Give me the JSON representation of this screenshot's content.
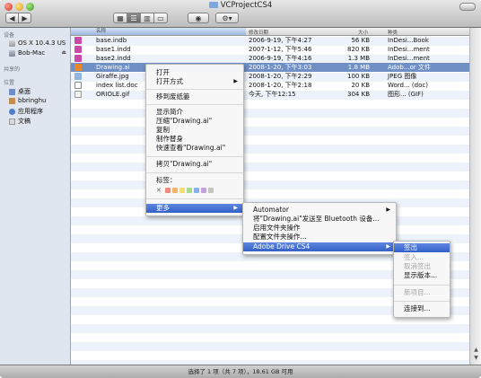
{
  "window": {
    "title": "VCProjectCS4"
  },
  "toolbar": {
    "back": "◀",
    "forward": "▶",
    "quicklook": "◉",
    "action": "⚙▾"
  },
  "sidebar": {
    "devices_header": "设备",
    "devices": [
      {
        "label": "OS X 10.4.3 US",
        "icon": "hard-disk-icon"
      },
      {
        "label": "Bob-Mac",
        "icon": "computer-icon",
        "eject": "⏏"
      }
    ],
    "shared_header": "共享的",
    "places_header": "位置",
    "places": [
      {
        "label": "桌面",
        "icon": "desktop-icon"
      },
      {
        "label": "bbringhu",
        "icon": "home-icon"
      },
      {
        "label": "应用程序",
        "icon": "applications-icon"
      },
      {
        "label": "文稿",
        "icon": "documents-icon"
      }
    ]
  },
  "columns": {
    "name": "名称",
    "date": "修改日期",
    "size": "大小",
    "kind": "种类"
  },
  "files": [
    {
      "name": "base.indb",
      "date": "2006-9-19, 下午4:27",
      "size": "56 KB",
      "kind": "InDesi...Book",
      "type": "indd"
    },
    {
      "name": "base1.indd",
      "date": "2007-1-12, 下午5:46",
      "size": "820 KB",
      "kind": "InDesi...ment",
      "type": "indd"
    },
    {
      "name": "base2.indd",
      "date": "2006-9-19, 下午4:16",
      "size": "1.3 MB",
      "kind": "InDesi...ment",
      "type": "indd"
    },
    {
      "name": "Drawing.ai",
      "date": "2008-1-20, 下午3:03",
      "size": "1.8 MB",
      "kind": "Adob...or 文件",
      "type": "ai",
      "selected": true
    },
    {
      "name": "Giraffe.jpg",
      "date": "2008-1-20, 下午2:29",
      "size": "100 KB",
      "kind": "JPEG 图像",
      "type": "jpg"
    },
    {
      "name": "index list.doc",
      "date": "2008-1-20, 下午2:18",
      "size": "20 KB",
      "kind": "Word... (doc)",
      "type": "doc"
    },
    {
      "name": "ORIOLE.gif",
      "date": "今天, 下午12:15",
      "size": "304 KB",
      "kind": "图形... (GIF)",
      "type": "gif"
    }
  ],
  "context_menu": {
    "open": "打开",
    "open_with": "打开方式",
    "move_to_trash": "移到废纸篓",
    "get_info": "显示简介",
    "compress": "压缩\"Drawing.ai\"",
    "duplicate": "复制",
    "make_alias": "制作替身",
    "quick_look": "快速查看\"Drawing.ai\"",
    "copy": "拷贝\"Drawing.ai\"",
    "label": "标签：",
    "label_clear": "✕",
    "label_colors": [
      "#f08a7c",
      "#f2b36a",
      "#f1dd74",
      "#a9d98a",
      "#86b1ea",
      "#c7a2e0",
      "#c4c4c4"
    ],
    "more": "更多"
  },
  "more_menu": {
    "automator": "Automator",
    "send_bluetooth": "将\"Drawing.ai\"发送至 Bluetooth 设备...",
    "enable_folder_actions": "启用文件夹操作",
    "configure_folder_actions": "配置文件夹操作...",
    "adobe_drive": "Adobe Drive CS4"
  },
  "adobe_drive_menu": {
    "check_out": "签出",
    "check_in": "签入...",
    "cancel_check_out": "取消签出",
    "show_versions": "显示版本...",
    "new_item": "新项目...",
    "connect_to": "连接到..."
  },
  "status": "选择了 1 项（共 7 项），18.61 GB 可用"
}
